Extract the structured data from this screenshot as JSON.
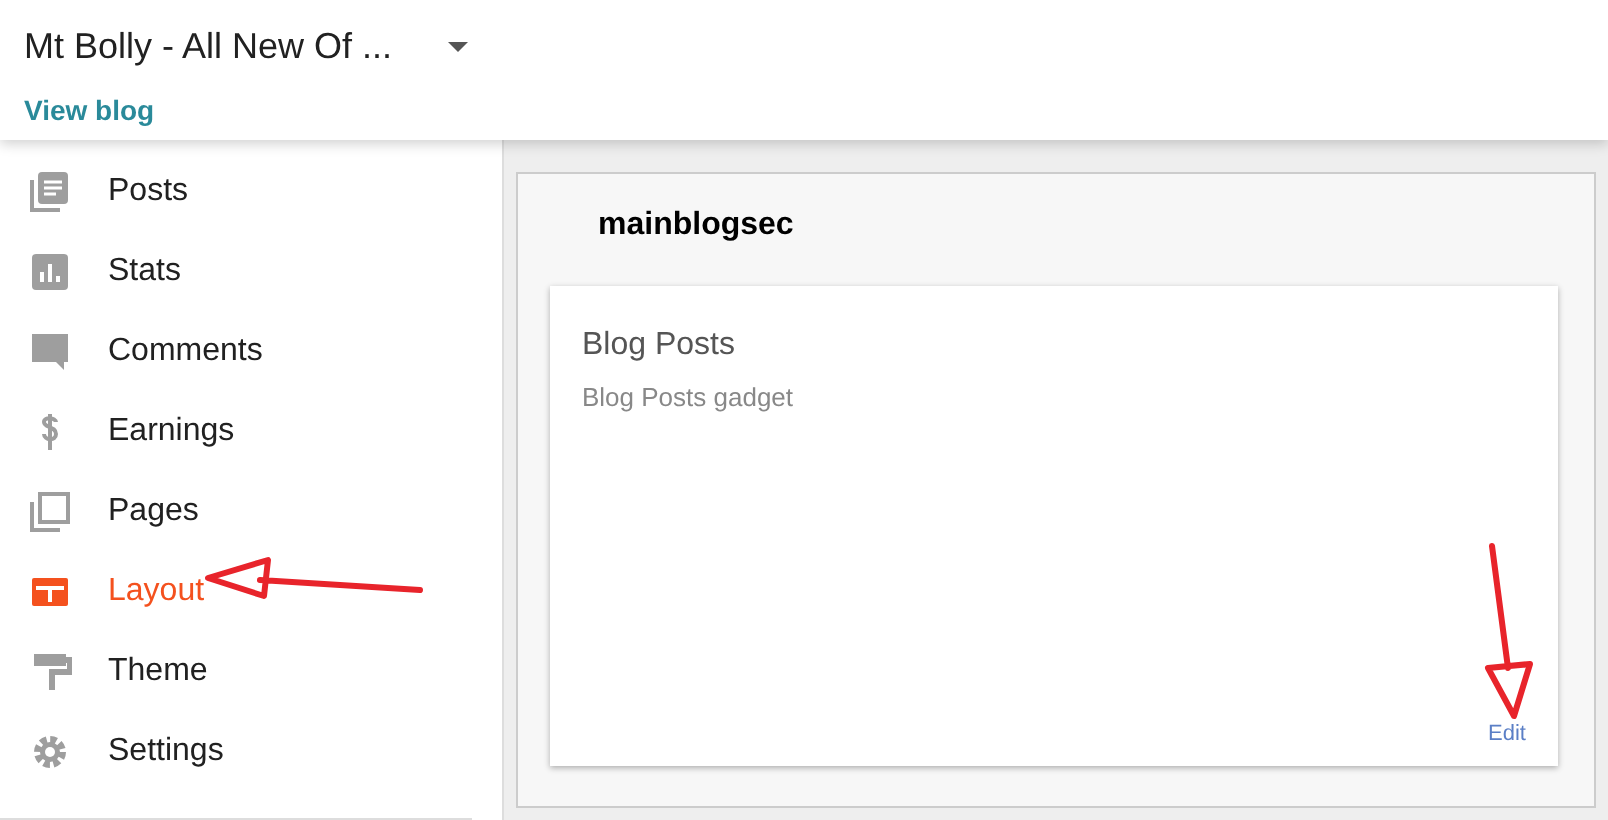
{
  "header": {
    "blog_title": "Mt Bolly - All New Of ...",
    "view_blog": "View blog"
  },
  "sidebar": {
    "items": [
      {
        "kind": "posts",
        "label": "Posts",
        "selected": false
      },
      {
        "kind": "stats",
        "label": "Stats",
        "selected": false
      },
      {
        "kind": "comments",
        "label": "Comments",
        "selected": false
      },
      {
        "kind": "earnings",
        "label": "Earnings",
        "selected": false
      },
      {
        "kind": "pages",
        "label": "Pages",
        "selected": false
      },
      {
        "kind": "layout",
        "label": "Layout",
        "selected": true
      },
      {
        "kind": "theme",
        "label": "Theme",
        "selected": false
      },
      {
        "kind": "settings",
        "label": "Settings",
        "selected": false
      }
    ]
  },
  "section": {
    "title": "mainblogsec",
    "gadgets": [
      {
        "title": "Blog Posts",
        "description": "Blog Posts gadget",
        "edit": "Edit"
      }
    ]
  }
}
